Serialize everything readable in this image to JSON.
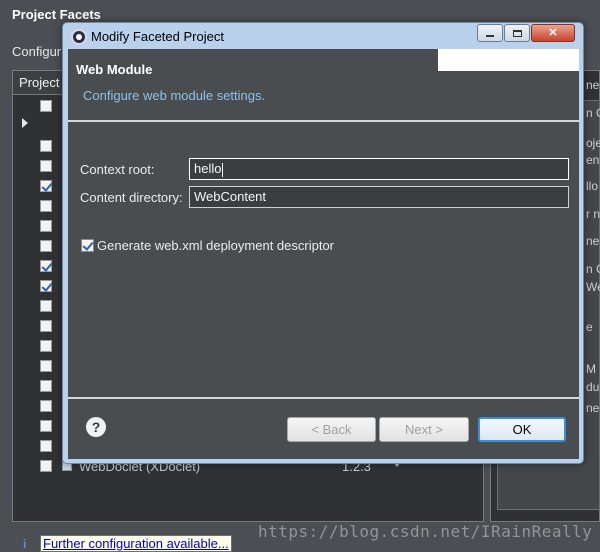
{
  "background": {
    "title": "Project Facets",
    "configure_text": "Configur",
    "tab_label": "Project",
    "row_label": "WebDoclet (XDoclet)",
    "row_version": "1.2.3",
    "right_fragments": [
      "nes",
      "n C",
      "oje",
      "ent",
      "llo",
      "r ne",
      "ne",
      "n C",
      "We",
      "e",
      "M",
      "dule",
      "ne",
      "ne"
    ],
    "link_icon": "i",
    "link_text": "Further configuration available...",
    "watermark": "https://blog.csdn.net/IRainReally"
  },
  "dialog": {
    "title": "Modify Faceted Project",
    "window_buttons": {
      "minimize_icon": "minimize-icon",
      "maximize_icon": "maximize-icon",
      "close_glyph": "✕"
    },
    "header": {
      "title": "Web Module",
      "description": "Configure web module settings."
    },
    "fields": {
      "context_root_label": "Context root:",
      "context_root_value": "hello",
      "content_dir_label": "Content directory:",
      "content_dir_value": "WebContent"
    },
    "checkbox": {
      "label": "Generate web.xml deployment descriptor",
      "checked": true
    },
    "buttons": {
      "help_glyph": "?",
      "back": "< Back",
      "next": "Next >",
      "ok": "OK"
    }
  }
}
